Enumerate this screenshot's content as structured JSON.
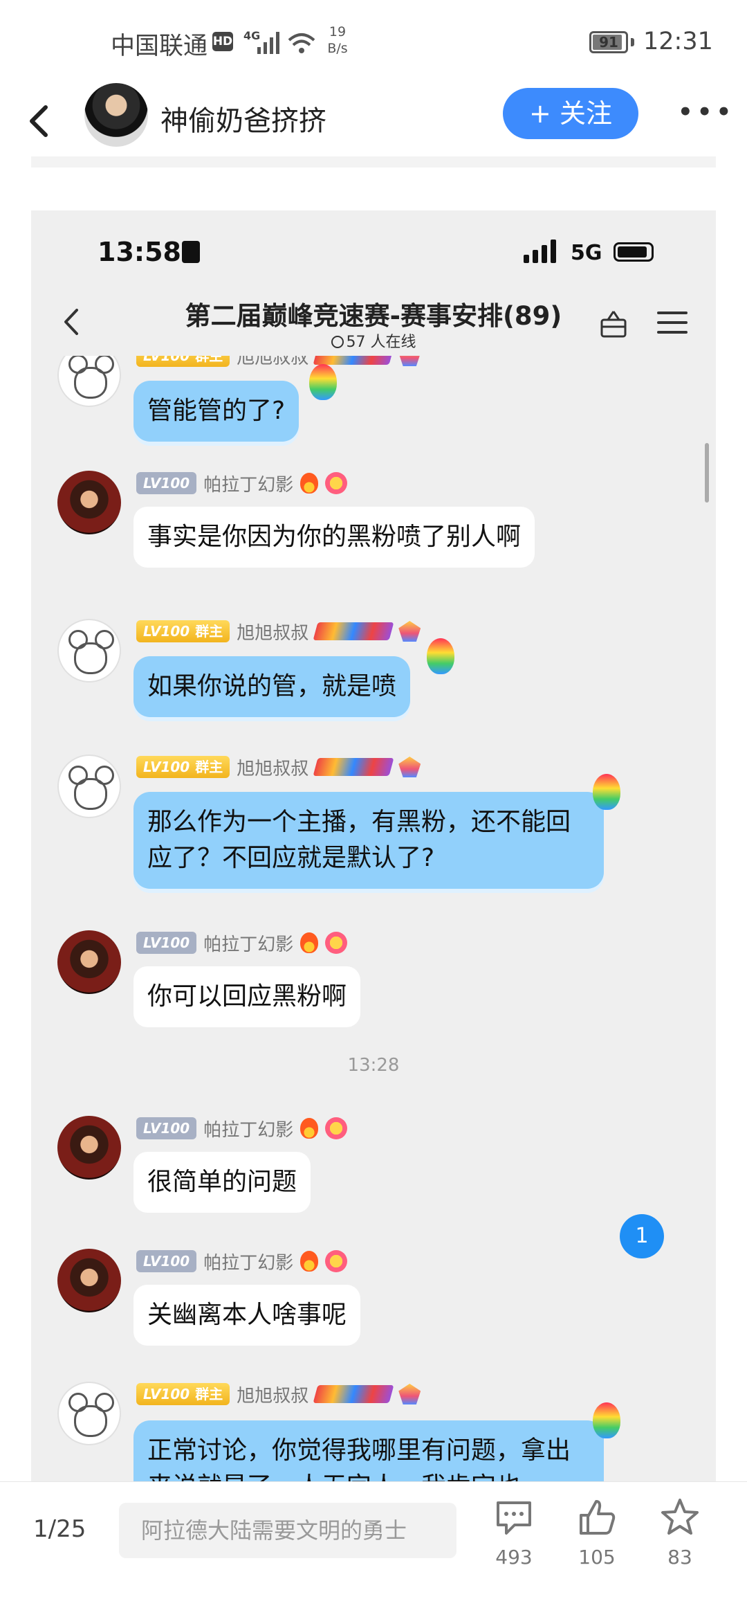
{
  "status_bar": {
    "carrier": "中国联通",
    "hd": "HD",
    "network": "4G",
    "speed_value": "19",
    "speed_unit": "B/s",
    "battery": "91",
    "battery_level": 0.91,
    "time": "12:31"
  },
  "header": {
    "poster_name": "神偷奶爸挤挤",
    "follow_label": "+ 关注",
    "more_label": "•••"
  },
  "screenshot": {
    "status": {
      "time": "13:58",
      "network": "5G"
    },
    "nav": {
      "title": "第二届巅峰竞速赛-赛事安排(89)",
      "online": "57 人在线"
    },
    "messages": [
      {
        "sender": "旭旭叔叔",
        "level": "LV100",
        "role": "群主",
        "text": "管能管的了?"
      },
      {
        "sender": "帕拉丁幻影",
        "level": "LV100",
        "role": "",
        "text": "事实是你因为你的黑粉喷了别人啊"
      },
      {
        "sender": "旭旭叔叔",
        "level": "LV100",
        "role": "群主",
        "text": "如果你说的管，就是喷"
      },
      {
        "sender": "旭旭叔叔",
        "level": "LV100",
        "role": "群主",
        "text": "那么作为一个主播，有黑粉，还不能回应了？不回应就是默认了?"
      },
      {
        "sender": "帕拉丁幻影",
        "level": "LV100",
        "role": "",
        "text": "你可以回应黑粉啊"
      },
      {
        "sender": "帕拉丁幻影",
        "level": "LV100",
        "role": "",
        "text": "很简单的问题"
      },
      {
        "sender": "帕拉丁幻影",
        "level": "LV100",
        "role": "",
        "text": "关幽离本人啥事呢"
      },
      {
        "sender": "旭旭叔叔",
        "level": "LV100",
        "role": "群主",
        "text": "正常讨论，你觉得我哪里有问题，拿出来说就是了，人无完人，我肯定也"
      }
    ],
    "time_divider": "13:28",
    "unread_count": "1"
  },
  "bottom_bar": {
    "page_indicator": "1/25",
    "comment_placeholder": "阿拉德大陆需要文明的勇士",
    "comments_count": "493",
    "likes_count": "105",
    "favorites_count": "83"
  },
  "colors": {
    "accent": "#3d8bfd",
    "bubble_blue": "#91d0fb",
    "unread_badge": "#1f8ff5"
  },
  "icons": [
    "back-icon",
    "more-icon",
    "gift-icon",
    "menu-icon",
    "comment-icon",
    "like-icon",
    "favorite-icon"
  ]
}
